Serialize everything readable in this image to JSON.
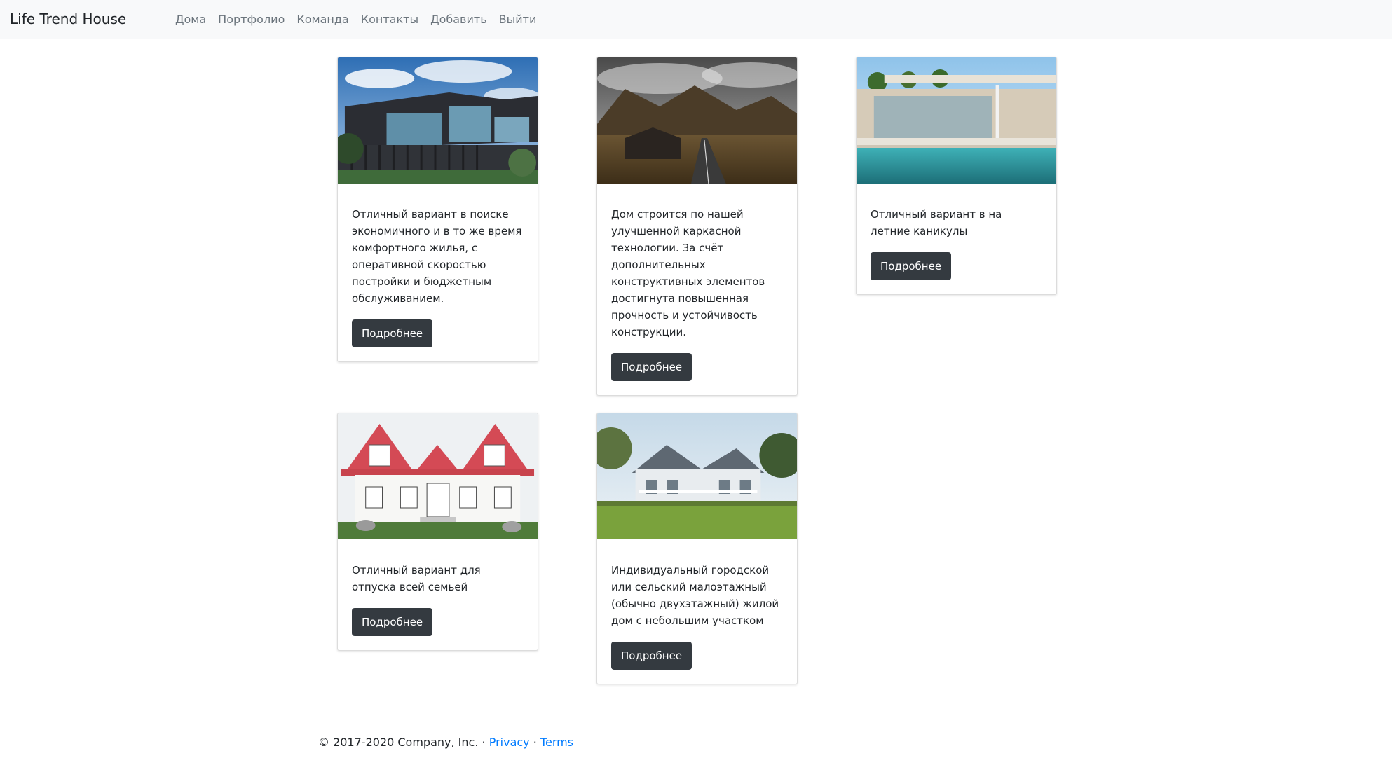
{
  "navbar": {
    "brand": "Life Trend House",
    "links": [
      "Дома",
      "Портфолио",
      "Команда",
      "Контакты",
      "Добавить",
      "Выйти"
    ]
  },
  "cards": [
    {
      "text": "Отличный вариант в поиске экономичного и в то же время комфортного жилья, с оперативной скоростью постройки и бюджетным обслуживанием.",
      "button": "Подробнее",
      "image": "modern-black-house-photo"
    },
    {
      "text": "Дом строится по нашей улучшенной каркасной технологии. За счёт дополнительных конструктивных элементов достигнута повышенная прочность и устойчивость конструкции.",
      "button": "Подробнее",
      "image": "mountain-road-house-photo"
    },
    {
      "text": "Отличный вариант в на летние каникулы",
      "button": "Подробнее",
      "image": "pool-villa-photo"
    },
    {
      "text": "Отличный вариант для отпуска всей семьей",
      "button": "Подробнее",
      "image": "white-red-roof-house-photo"
    },
    {
      "text": "Индивидуальный городской или сельский малоэтажный (обычно двухэтажный) жилой дом с небольшим участком",
      "button": "Подробнее",
      "image": "suburban-house-photo"
    }
  ],
  "footer": {
    "copyright": "© 2017-2020 Company, Inc.",
    "separator": "·",
    "privacy": "Privacy",
    "terms": "Terms"
  },
  "colors": {
    "navbar_bg": "#f8f9fa",
    "button_bg": "#343a40",
    "link": "#007bff"
  }
}
